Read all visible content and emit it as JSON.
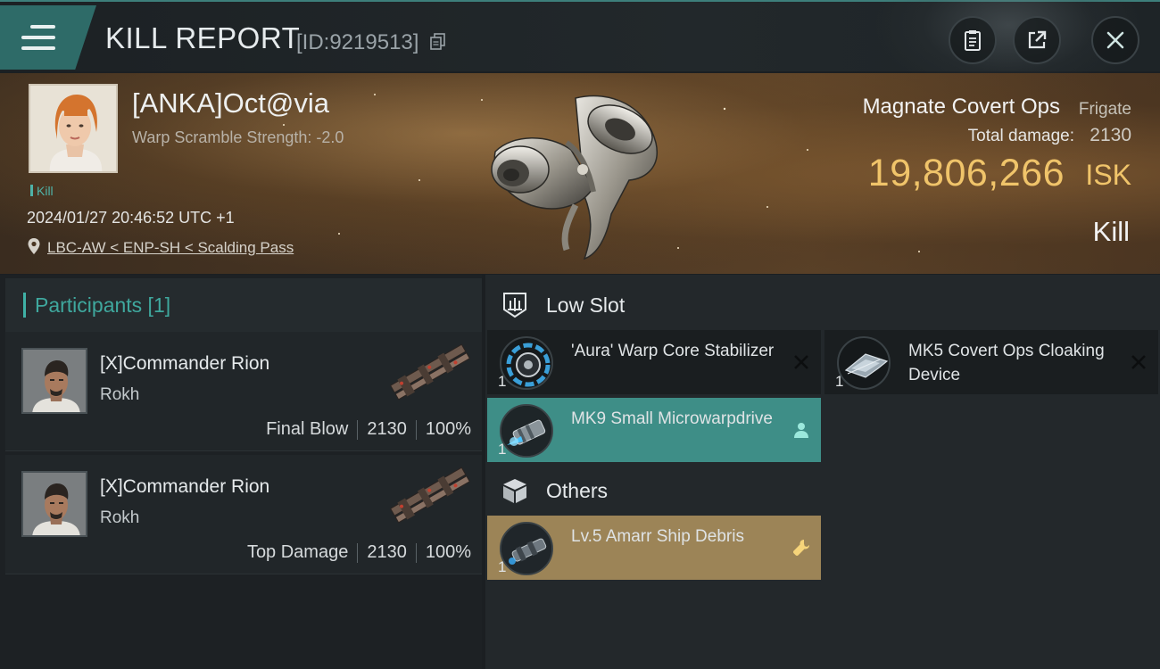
{
  "header": {
    "title": "KILL REPORT",
    "report_id": "[ID:9219513]",
    "icons": [
      "menu-icon",
      "copy-icon",
      "clipboard-icon",
      "share-icon",
      "close-icon"
    ]
  },
  "victim": {
    "name": "[ANKA]Oct@via",
    "warp_scramble": "Warp Scramble Strength: -2.0",
    "kill_tag": "Kill",
    "timestamp": "2024/01/27 20:46:52 UTC +1",
    "location": "LBC-AW < ENP-SH < Scalding Pass",
    "ship_name": "Magnate Covert Ops",
    "ship_class": "Frigate",
    "total_damage_label": "Total damage:",
    "total_damage": "2130",
    "isk_value": "19,806,266",
    "isk_unit": "ISK",
    "result": "Kill"
  },
  "participants": {
    "header": "Participants [1]",
    "list": [
      {
        "name": "[X]Commander Rion",
        "ship": "Rokh",
        "role": "Final Blow",
        "damage": "2130",
        "percent": "100%"
      },
      {
        "name": "[X]Commander Rion",
        "ship": "Rokh",
        "role": "Top Damage",
        "damage": "2130",
        "percent": "100%"
      }
    ]
  },
  "items": {
    "low_slot": {
      "label": "Low Slot",
      "list": [
        {
          "name": "'Aura' Warp Core Stabilizer",
          "qty": "1",
          "status": "destroyed",
          "status_icon": "x-icon"
        },
        {
          "name": "MK5 Covert Ops Cloaking Device",
          "qty": "1",
          "status": "destroyed",
          "status_icon": "x-icon"
        },
        {
          "name": "MK9 Small Microwarpdrive",
          "qty": "1",
          "status": "dropped",
          "status_icon": "person-icon"
        }
      ]
    },
    "others": {
      "label": "Others",
      "list": [
        {
          "name": "Lv.5 Amarr Ship Debris",
          "qty": "1",
          "status": "salvage",
          "status_icon": "wrench-icon"
        }
      ]
    }
  },
  "colors": {
    "accent_teal": "#3e8e87",
    "isk_gold": "#f0c46a",
    "debris_gold": "#9c8457"
  }
}
